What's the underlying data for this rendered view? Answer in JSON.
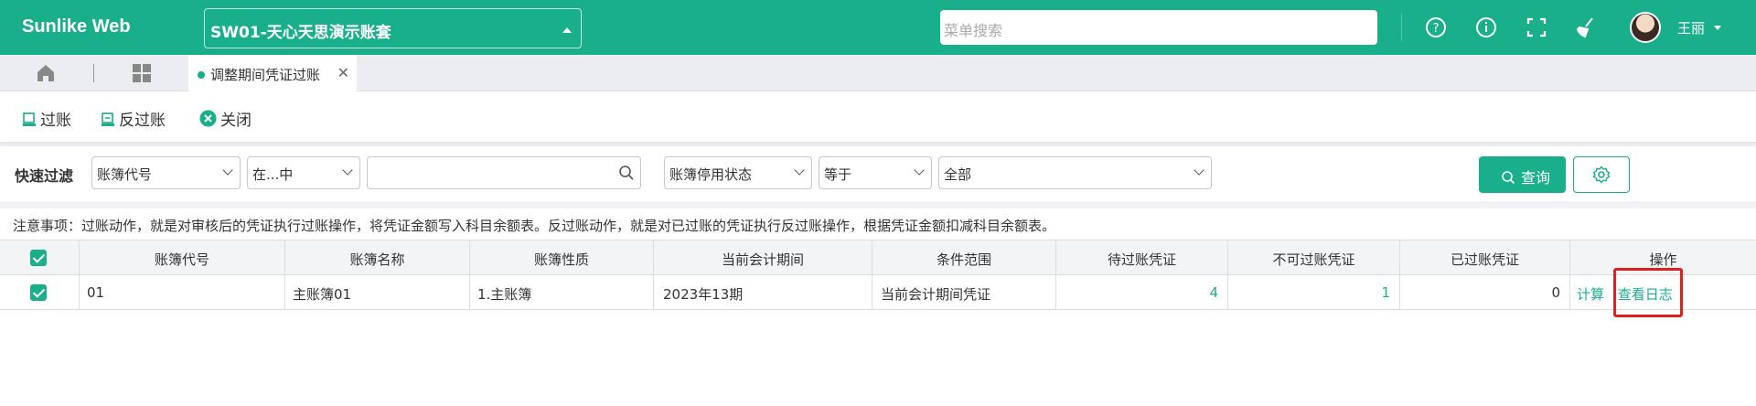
{
  "app": {
    "logo": "Sunlike Web",
    "account": "SW01-天心天思演示账套",
    "search_placeholder": "菜单搜索",
    "user": "王丽"
  },
  "tabs": {
    "active": "调整期间凭证过账"
  },
  "toolbar": {
    "post": "过账",
    "unpost": "反过账",
    "close": "关闭"
  },
  "filter": {
    "label": "快速过滤",
    "field1": "账簿代号",
    "op1": "在...中",
    "value1": "",
    "field2": "账簿停用状态",
    "op2": "等于",
    "value2": "全部",
    "query": "查询"
  },
  "notice": "注意事项：过账动作，就是对审核后的凭证执行过账操作，将凭证金额写入科目余额表。反过账动作，就是对已过账的凭证执行反过账操作，根据凭证金额扣减科目余额表。",
  "table": {
    "headers": [
      "账簿代号",
      "账簿名称",
      "账簿性质",
      "当前会计期间",
      "条件范围",
      "待过账凭证",
      "不可过账凭证",
      "已过账凭证",
      "操作"
    ],
    "rows": [
      {
        "code": "01",
        "name": "主账簿01",
        "nature": "1.主账簿",
        "period": "2023年13期",
        "scope": "当前会计期间凭证",
        "pending": "4",
        "unpostable": "1",
        "posted": "0",
        "action1": "计算",
        "action2": "查看日志"
      }
    ]
  },
  "colors": {
    "primary": "#1aaf8b",
    "highlight": "#e02020"
  }
}
